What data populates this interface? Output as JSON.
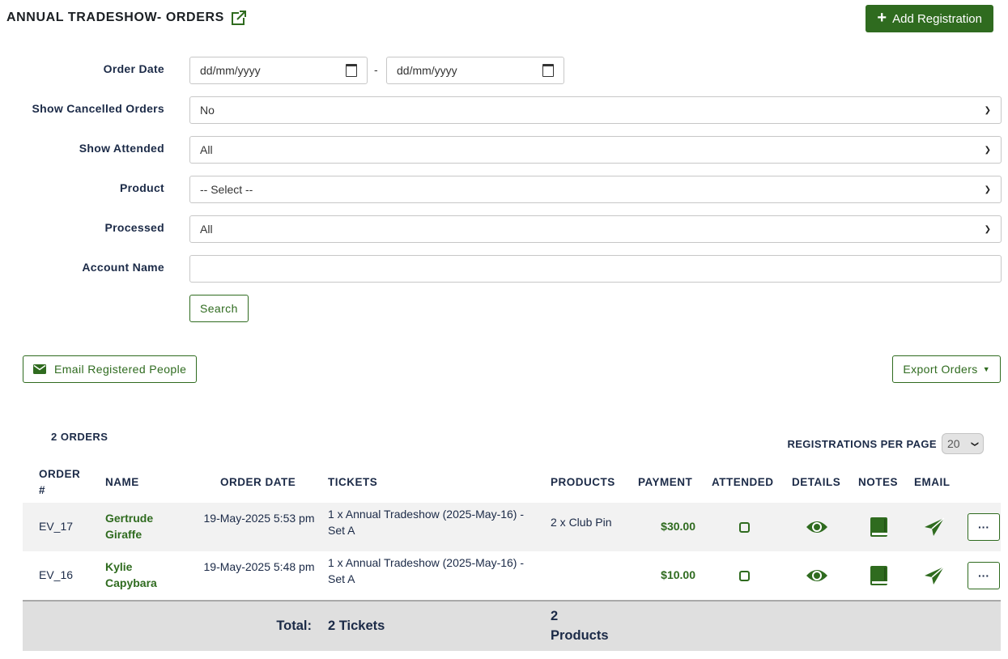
{
  "header": {
    "title": "ANNUAL TRADESHOW- ORDERS",
    "add_button": "Add Registration"
  },
  "filters": {
    "order_date_label": "Order Date",
    "date_placeholder": "dd/mm/yyyy",
    "date_separator": "-",
    "show_cancelled_label": "Show Cancelled Orders",
    "show_cancelled_value": "No",
    "show_attended_label": "Show Attended",
    "show_attended_value": "All",
    "product_label": "Product",
    "product_value": "-- Select --",
    "processed_label": "Processed",
    "processed_value": "All",
    "account_name_label": "Account Name",
    "account_name_value": "",
    "search_button": "Search"
  },
  "actions": {
    "email_button": "Email Registered People",
    "export_button": "Export Orders"
  },
  "orders": {
    "count_label": "2 ORDERS",
    "per_page_label": "REGISTRATIONS PER PAGE",
    "per_page_value": "20",
    "columns": [
      "ORDER #",
      "NAME",
      "ORDER DATE",
      "TICKETS",
      "PRODUCTS",
      "PAYMENT",
      "ATTENDED",
      "DETAILS",
      "NOTES",
      "EMAIL"
    ],
    "rows": [
      {
        "order": "EV_17",
        "name": "Gertrude Giraffe",
        "date": "19-May-2025 5:53 pm",
        "tickets": "1 x Annual Tradeshow (2025-May-16) - Set A",
        "products": "2 x Club Pin",
        "payment": "$30.00"
      },
      {
        "order": "EV_16",
        "name": "Kylie Capybara",
        "date": "19-May-2025 5:48 pm",
        "tickets": "1 x Annual Tradeshow (2025-May-16) - Set A",
        "products": "",
        "payment": "$10.00"
      }
    ],
    "more_label": "···",
    "total": {
      "label": "Total:",
      "tickets": "2 Tickets",
      "products": "2 Products"
    }
  },
  "colors": {
    "primary_green": "#2f6b1f",
    "text_navy": "#1b2a47"
  },
  "icons": {
    "external_link": "external-link-icon",
    "plus": "plus-icon",
    "envelope": "envelope-icon",
    "eye": "eye-icon",
    "book": "book-icon",
    "send": "paper-plane-icon"
  }
}
